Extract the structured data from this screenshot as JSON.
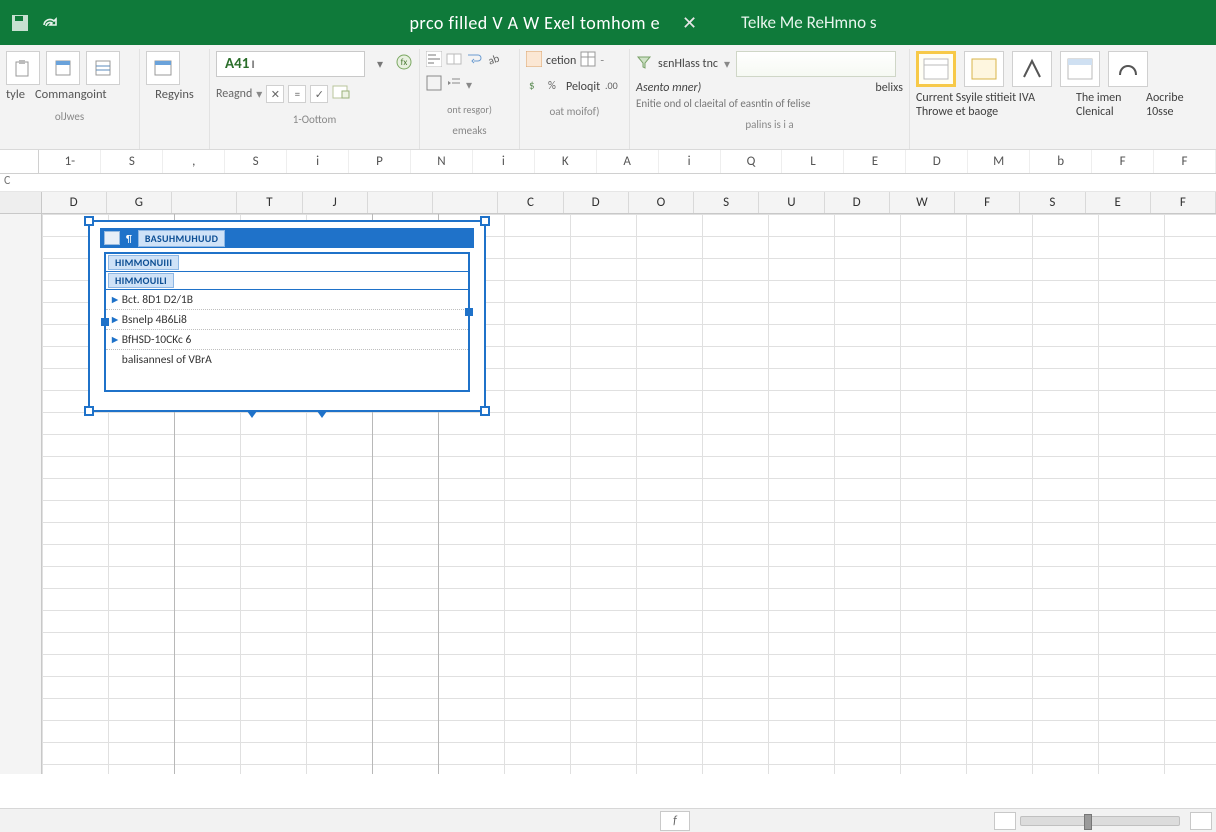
{
  "titlebar": {
    "doc_title": "prco filled V A W Exel tomhom e",
    "tell_me": "Telke Me ReHmno s"
  },
  "ribbon": {
    "group1": {
      "label1": "tyle",
      "label2": "Commangoint",
      "sub": "olJwes"
    },
    "group2": {
      "label": "Regyins"
    },
    "namebox": "A41",
    "fx": {
      "label": "Reagnd",
      "sub": "1-Oottom"
    },
    "group4": {
      "top": "cetion",
      "sub1": "ont resgor)",
      "sub2": "emeaks"
    },
    "group5": {
      "top": "sεnHlass tnc",
      "label": "Peloqit",
      "sub": "oat moifof)"
    },
    "group6": {
      "top": "Asento mner)",
      "line2": "Enitie ond ol claeital of easntin of felise",
      "sub": "palins is i a",
      "right": "belixs"
    },
    "styles": {
      "line1": "Current Ssyile stitieit IVA",
      "line2": "Throwe et baoge",
      "col3a": "The imen",
      "col3b": "Clenical",
      "col4a": "Aocribe",
      "col4b": "10sse"
    }
  },
  "colstrip_top": [
    "1-",
    "S",
    ",",
    "S",
    "i",
    "P",
    "N",
    "i",
    "K",
    "A",
    "i",
    "Q",
    "L",
    "E",
    "D",
    "M",
    "b",
    "F",
    "F"
  ],
  "left_c": "C",
  "col_headers": [
    "D",
    "G",
    "",
    "T",
    "J",
    "",
    "",
    "C",
    "D",
    "O",
    "S",
    "U",
    "D",
    "W",
    "F",
    "S",
    "E",
    "F"
  ],
  "table_object": {
    "title_chip": "BASUHMUHUUD",
    "header_chips": [
      "HIMMONUIII",
      "HIMMOUILI"
    ],
    "rows": [
      "Bct. 8D1 D2/1B",
      "Bsnelp 4B6Li8",
      "BfHSD-10CKc 6",
      "balisannesl of VBrA"
    ]
  },
  "statusbar": {
    "sheet_tab": "f"
  }
}
